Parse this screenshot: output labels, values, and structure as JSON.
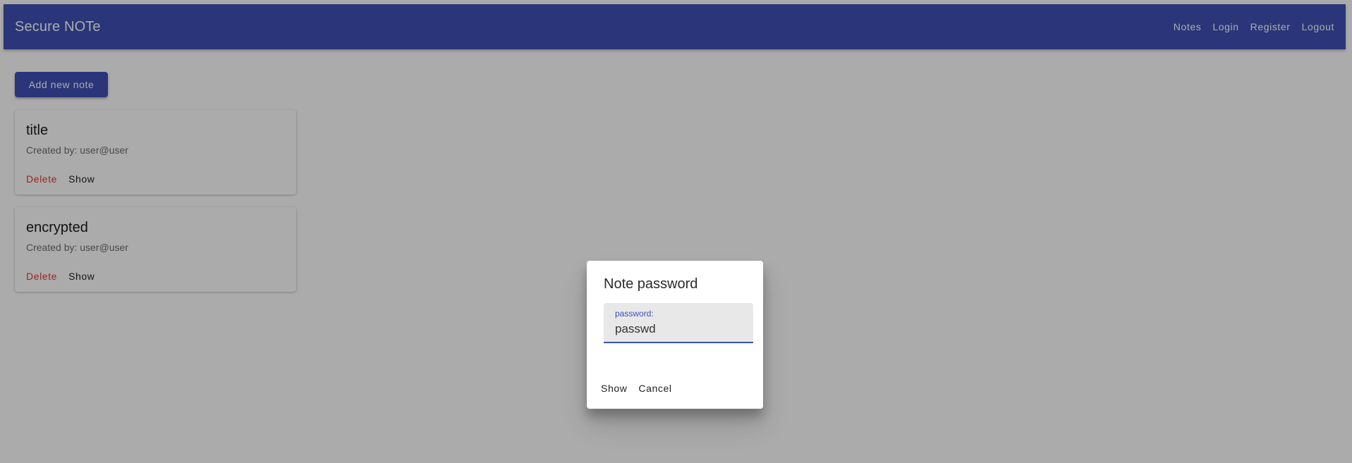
{
  "app": {
    "title": "Secure NOTe"
  },
  "nav": {
    "items": [
      {
        "label": "Notes"
      },
      {
        "label": "Login"
      },
      {
        "label": "Register"
      },
      {
        "label": "Logout"
      }
    ]
  },
  "toolbar": {
    "add_label": "Add new note"
  },
  "notes": [
    {
      "title": "title",
      "created_by": "Created by: user@user",
      "delete_label": "Delete",
      "show_label": "Show"
    },
    {
      "title": "encrypted",
      "created_by": "Created by: user@user",
      "delete_label": "Delete",
      "show_label": "Show"
    }
  ],
  "dialog": {
    "title": "Note password",
    "field_label": "password:",
    "field_value": "passwd",
    "show_label": "Show",
    "cancel_label": "Cancel"
  },
  "colors": {
    "primary": "#3f51b5",
    "danger": "#e53935",
    "overlay": "#a9a9a9"
  }
}
